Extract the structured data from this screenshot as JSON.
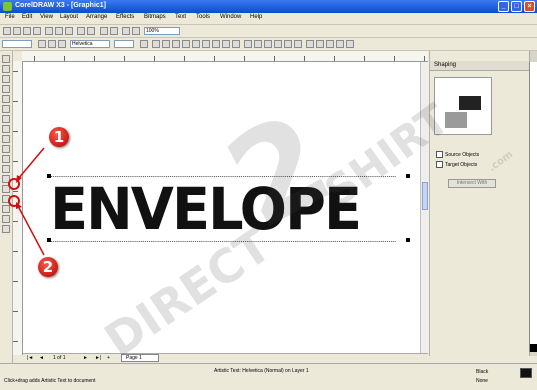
{
  "window": {
    "title": "CorelDRAW X3 - [Graphic1]"
  },
  "menu": [
    "File",
    "Edit",
    "View",
    "Layout",
    "Arrange",
    "Effects",
    "Bitmaps",
    "Text",
    "Tools",
    "Window",
    "Help"
  ],
  "toolbar": {
    "zoom_value": "100%",
    "font_name": "Helvetica"
  },
  "document": {
    "text": "ENVELOPE"
  },
  "docker": {
    "title": "Shaping",
    "option_1": "Source Objects",
    "option_2": "Target Objects",
    "apply_button": "Intersect With"
  },
  "page_nav": {
    "position": "1 of 1",
    "page_tab": "Page 1"
  },
  "status": {
    "center": "Artistic Text: Helvetica (Normal) on Layer 1",
    "fill_label": "Black",
    "outline_label": "None",
    "hint": "Click+drag adds Artistic Text to document"
  },
  "callouts": {
    "first": "1",
    "second": "2"
  },
  "watermark": {
    "line1": "DIRECT",
    "line2": "2",
    "line3": "SHIRT",
    "suffix": ".com"
  }
}
